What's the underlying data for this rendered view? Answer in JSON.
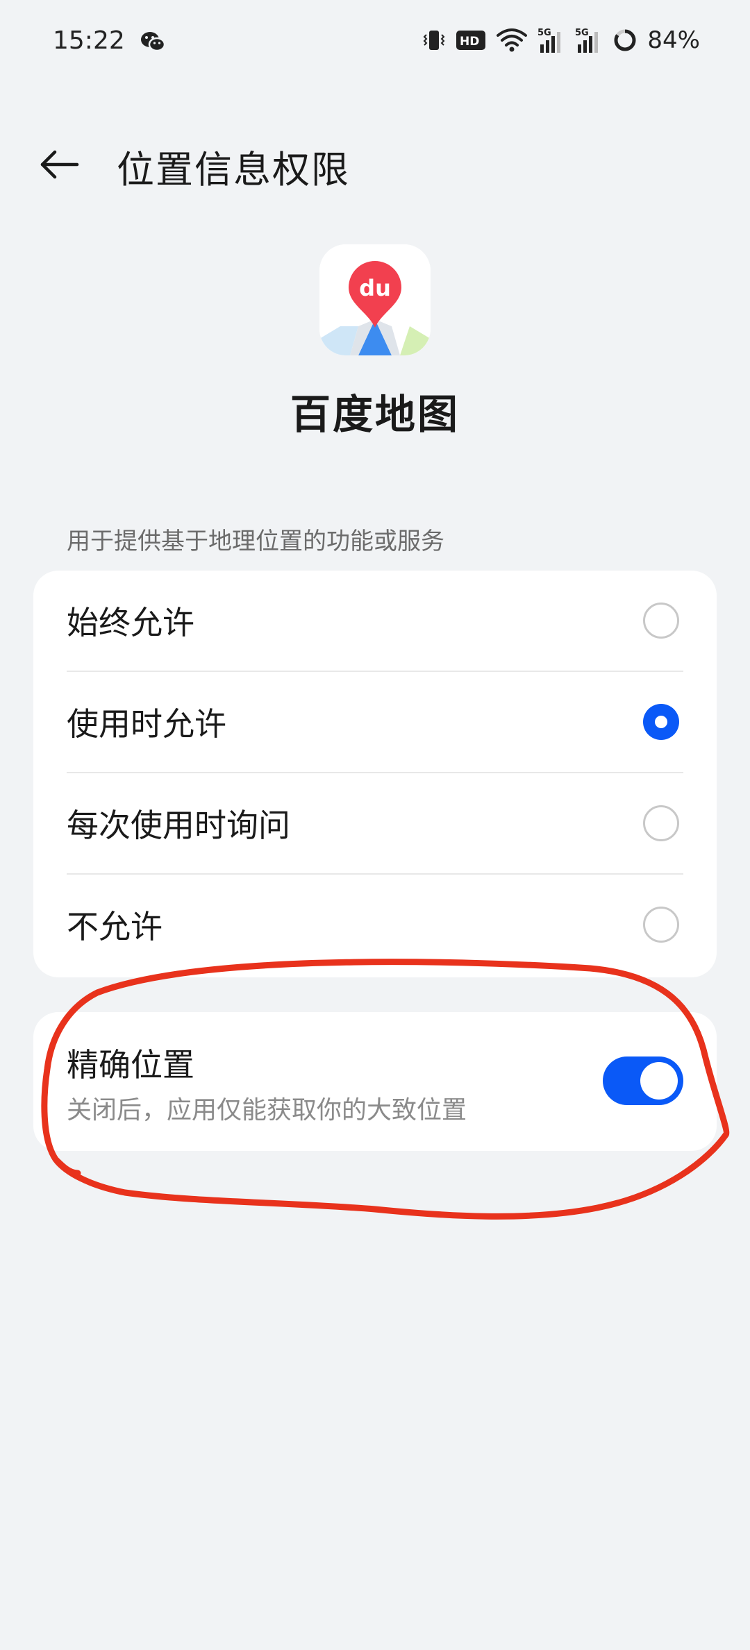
{
  "status_bar": {
    "time": "15:22",
    "battery": "84%",
    "icons": [
      "wechat-icon",
      "vibrate-icon",
      "hd-icon",
      "wifi-icon",
      "signal-5g-icon",
      "signal-5g-icon",
      "battery-ring-icon"
    ]
  },
  "header": {
    "back_icon": "arrow-left-icon",
    "title": "位置信息权限"
  },
  "app": {
    "name": "百度地图",
    "icon": "baidu-maps-logo",
    "logo_text": "du"
  },
  "permission": {
    "description": "用于提供基于地理位置的功能或服务",
    "options": [
      {
        "label": "始终允许",
        "selected": false
      },
      {
        "label": "使用时允许",
        "selected": true
      },
      {
        "label": "每次使用时询问",
        "selected": false
      },
      {
        "label": "不允许",
        "selected": false
      }
    ]
  },
  "precise_location": {
    "title": "精确位置",
    "subtitle": "关闭后，应用仅能获取你的大致位置",
    "enabled": true
  },
  "colors": {
    "accent": "#0a59f7",
    "background": "#f1f3f5",
    "annotation": "#e8321c"
  }
}
